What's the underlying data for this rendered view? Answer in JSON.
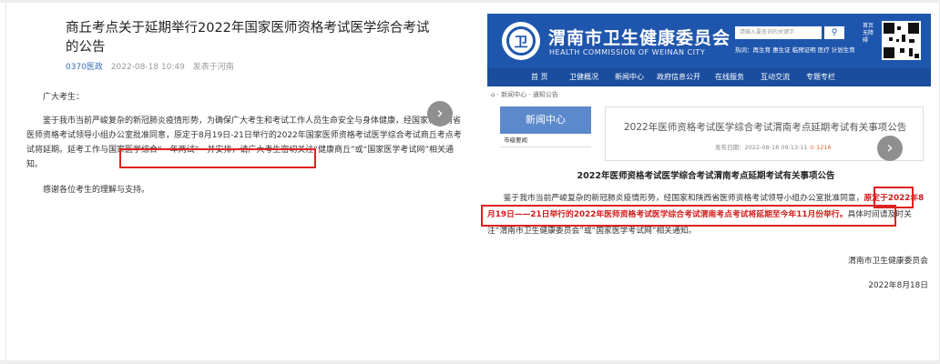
{
  "left_article": {
    "title": "商丘考点关于延期举行2022年国家医师资格考试医学综合考试的公告",
    "source": "0370医政",
    "date": "2022-08-18 10:49",
    "location": "发表于河南",
    "greeting": "广大考生：",
    "para1": "鉴于我市当前严峻复杂的新冠肺炎疫情形势，为确保广大考生和考试工作人员生命安全与身体健康，经国家和河南省医师资格考试领导小组办公室批准同意，原定于8月19日-21日举行的2022年国家医师资格考试医学综合考试商丘考点考试将延期。延考工作与国家医学综合“一年两试”一并安排，请广大考生密切关注“健康商丘”或“国家医学考试网”相关通知。",
    "para2": "感谢各位考生的理解与支持。"
  },
  "right_article": {
    "site_name": "渭南市卫生健康委员会",
    "site_en": "HEALTH COMMISSION OF WEINAN CITY",
    "search_placeholder": "请输入要查询的关键字",
    "hot_words": "热词：再生育  惠生证  临预证明  医疗  计划生育",
    "side_links": "首页 无障碍",
    "nav": [
      "首 页",
      "卫健概况",
      "新闻中心",
      "政府信息公开",
      "在线服务",
      "互动交流",
      "专题专栏"
    ],
    "breadcrumb": "⌂ · 新闻中心 · 通知公告",
    "side_head": "新闻中心",
    "side_sub": "市级要闻",
    "news_title": "2022年医师资格考试医学综合考试渭南考点延期考试有关事项公告",
    "news_date_label": "发布日期：2022-08-18 09:13:11",
    "news_views": "⊙ 1216",
    "heading": "2022年医师资格考试医学综合考试渭南考点延期考试有关事项公告",
    "body_start": "鉴于我市当前严峻复杂的新冠肺炎疫情形势，经国家和陕西省医师资格考试领导小组办公室批准同意，",
    "body_red": "原定于2022年8月19日——21日举行的2022年医师资格考试医学综合考试渭南考点考试将延期至今年11月份举行。",
    "body_end": "具体时间请及时关注“渭南市卫生健康委员会”或“国家医学考试网”相关通知。",
    "signature": "渭南市卫生健康委员会",
    "date": "2022年8月18日"
  },
  "icons": {
    "next_arrow_glyph": "›"
  },
  "colors": {
    "highlight": "#e02020",
    "site_blue": "#1f56ad",
    "red_text": "#d21919"
  }
}
